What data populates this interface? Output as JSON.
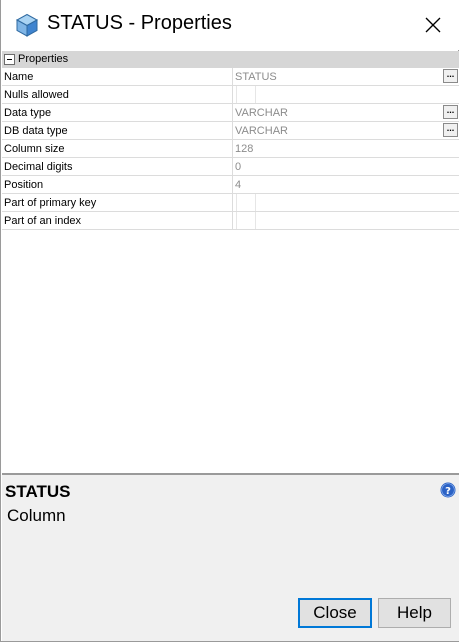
{
  "window": {
    "title": "STATUS - Properties"
  },
  "category": {
    "label": "Properties"
  },
  "properties": [
    {
      "name": "Name",
      "value": "STATUS",
      "kind": "text-ellipsis"
    },
    {
      "name": "Nulls allowed",
      "value": "",
      "kind": "checkbox"
    },
    {
      "name": "Data type",
      "value": "VARCHAR",
      "kind": "text-ellipsis"
    },
    {
      "name": "DB data type",
      "value": "VARCHAR",
      "kind": "text-ellipsis"
    },
    {
      "name": "Column size",
      "value": "128",
      "kind": "text"
    },
    {
      "name": "Decimal digits",
      "value": "0",
      "kind": "text"
    },
    {
      "name": "Position",
      "value": "4",
      "kind": "text"
    },
    {
      "name": "Part of primary key",
      "value": "",
      "kind": "checkbox"
    },
    {
      "name": "Part of an index",
      "value": "",
      "kind": "checkbox"
    }
  ],
  "ellipsis_label": "...",
  "description": {
    "title": "STATUS",
    "subtitle": "Column"
  },
  "buttons": {
    "close": "Close",
    "help": "Help"
  },
  "icons": {
    "app": "cube-icon",
    "close": "close-icon",
    "help": "help-icon",
    "collapse": "minus-icon"
  },
  "colors": {
    "accent": "#0078d7",
    "help_icon": "#2b62c5",
    "category_bar": "#d6d6d6",
    "panel": "#f0f0f0"
  }
}
